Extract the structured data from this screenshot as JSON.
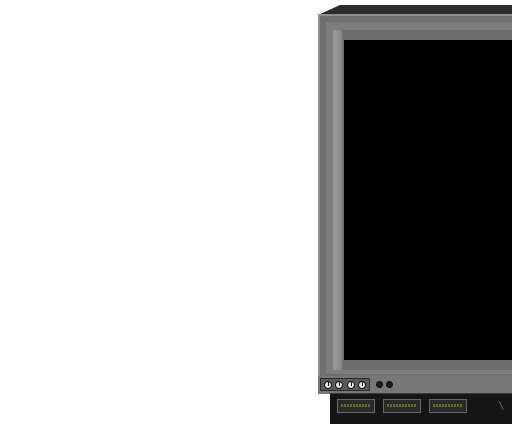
{
  "scene": {
    "background_color": "#ffffff",
    "monitor": {
      "screen_color": "#000000",
      "bezel_color": "#6f6f6f",
      "knobs": [
        "knob-icon",
        "knob-icon",
        "knob-icon",
        "knob-icon"
      ],
      "indicator_lights": [
        "led-icon",
        "led-icon"
      ],
      "drive_bays": [
        "drive-bay",
        "drive-bay",
        "drive-bay"
      ],
      "corner_glyph": "\\"
    }
  }
}
